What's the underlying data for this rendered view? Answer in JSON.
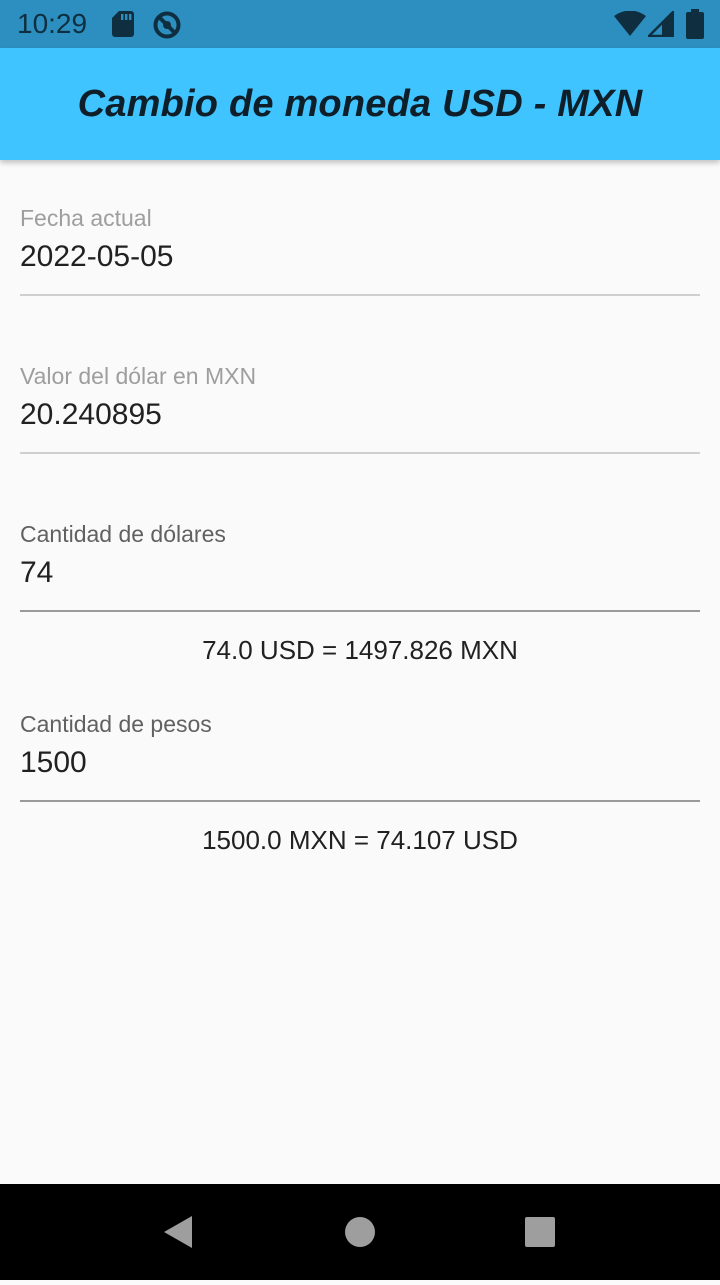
{
  "status_bar": {
    "time": "10:29",
    "icons_left": [
      "sd-card-icon",
      "do-not-disturb-icon"
    ],
    "icons_right": [
      "wifi-icon",
      "signal-icon",
      "battery-icon"
    ]
  },
  "app_bar": {
    "title": "Cambio de moneda USD - MXN",
    "color": "#40c4ff"
  },
  "form": {
    "date": {
      "label": "Fecha actual",
      "value": "2022-05-05"
    },
    "rate": {
      "label": "Valor del dólar en MXN",
      "value": "20.240895"
    },
    "dollars": {
      "label": "Cantidad de dólares",
      "value": "74",
      "result": "74.0 USD = 1497.826 MXN"
    },
    "pesos": {
      "label": "Cantidad de pesos",
      "value": "1500",
      "result": "1500.0 MXN = 74.107 USD"
    }
  },
  "nav_bar": {
    "buttons": [
      "back-icon",
      "home-icon",
      "recents-icon"
    ]
  }
}
